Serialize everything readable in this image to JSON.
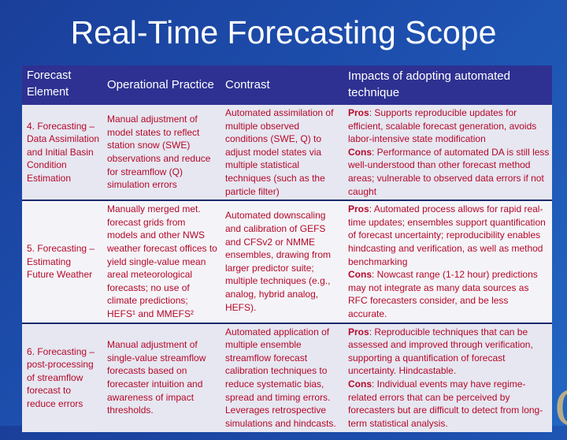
{
  "slide": {
    "title": "Real-Time Forecasting Scope",
    "watermark": "RECLAMATION"
  },
  "colors": {
    "header_bg": "#2e3192",
    "body_text": "#b5082a",
    "row_shaded": "#e6e7f1",
    "row_light": "#f4f4f8",
    "watermark": "#b9ad88"
  },
  "table": {
    "headers": [
      "Forecast Element",
      "Operational Practice",
      "Contrast",
      "Impacts of adopting automated technique"
    ],
    "rows": [
      {
        "element": "4. Forecasting – Data Assimilation and Initial Basin Condition Estimation",
        "practice": "Manual adjustment of model states to reflect station snow (SWE) observations and reduce for streamflow (Q) simulation errors",
        "contrast": "Automated assimilation of multiple observed conditions (SWE, Q) to adjust model states via multiple statistical techniques (such as the particle filter)",
        "pros_label": "Pros",
        "pros": ":  Supports reproducible updates for efficient, scalable forecast generation, avoids labor-intensive state modification",
        "cons_label": "Cons",
        "cons": ":  Performance of automated DA is still less well-understood than other forecast method areas; vulnerable to observed data errors if not caught"
      },
      {
        "element": "5. Forecasting – Estimating Future Weather",
        "practice": "Manually merged met. forecast grids from models and other NWS weather forecast offices to yield single-value mean areal meteorological forecasts; no use of climate predictions; HEFS¹ and MMEFS²",
        "contrast": "Automated downscaling and calibration of GEFS and CFSv2 or NMME ensembles, drawing from larger predictor suite; multiple techniques (e.g., analog, hybrid analog, HEFS).",
        "pros_label": "Pros",
        "pros": ":  Automated process allows for rapid real-time updates; ensembles support quantification of forecast uncertainty; reproducibility enables hindcasting and verification, as well as method benchmarking",
        "cons_label": "Cons",
        "cons": ":  Nowcast range (1-12 hour) predictions may not integrate as many data sources as RFC forecasters consider, and be less accurate."
      },
      {
        "element": "6. Forecasting – post-processing of streamflow forecast to reduce errors",
        "practice": "Manual adjustment of single-value streamflow forecasts based on forecaster intuition and awareness of impact thresholds.",
        "contrast": "Automated application of multiple ensemble streamflow forecast calibration techniques to reduce systematic bias, spread and timing errors. Leverages retrospective simulations and hindcasts.",
        "pros_label": "Pros",
        "pros": ":  Reproducible techniques that can be assessed and improved through verification, supporting a quantification of forecast uncertainty.  Hindcastable.",
        "cons_label": "Cons",
        "cons": ":  Individual events may have regime-related errors that can be perceived by forecasters but are difficult to detect from long-term statistical analysis."
      }
    ]
  }
}
